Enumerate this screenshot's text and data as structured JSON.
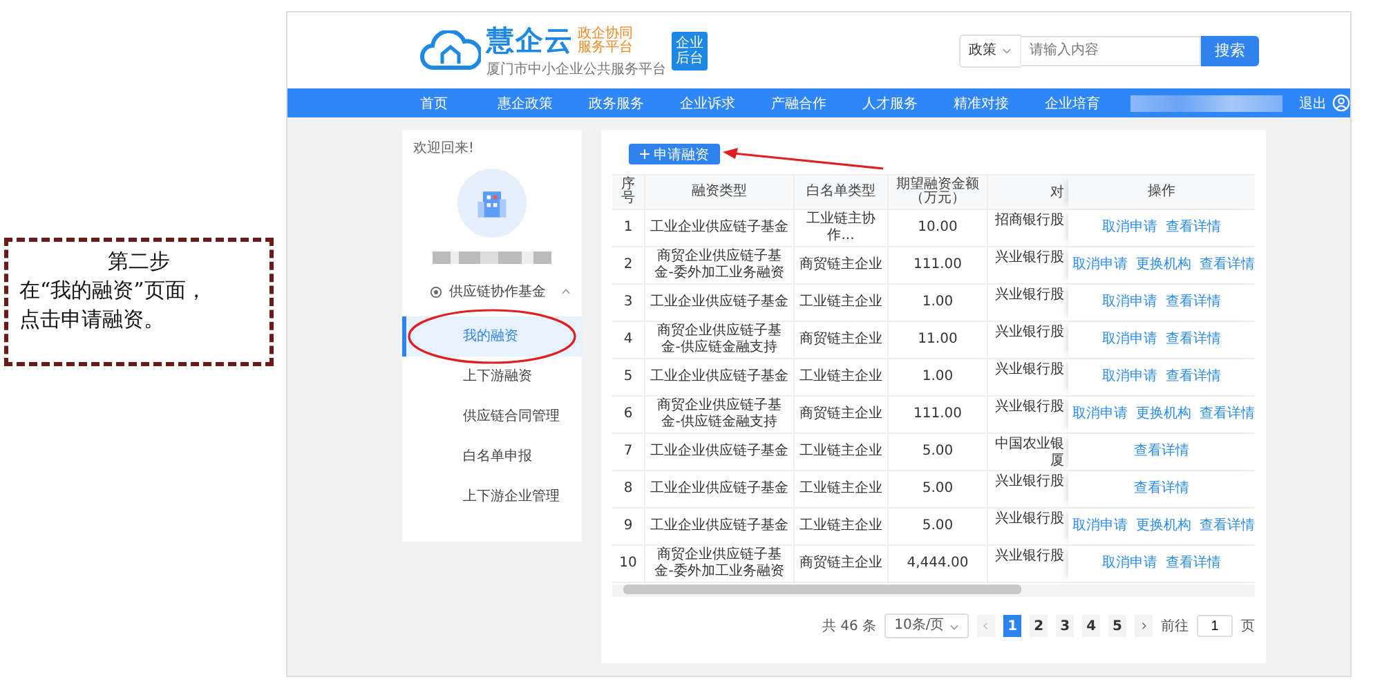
{
  "annotation": {
    "title": "第二步",
    "lines": [
      "在“我的融资”页面，",
      "点击申请融资。"
    ]
  },
  "header": {
    "brand": "慧企云",
    "slogan_lines": [
      "政企协同",
      "服务平台"
    ],
    "subtitle": "厦门市中小企业公共服务平台",
    "badge_lines": [
      "企业",
      "后台"
    ],
    "search": {
      "category": "政策",
      "placeholder": "请输入内容",
      "button": "搜索"
    }
  },
  "nav": {
    "items": [
      "首页",
      "惠企政策",
      "政务服务",
      "企业诉求",
      "产融合作",
      "人才服务",
      "精准对接",
      "企业培育"
    ],
    "logout": "退出"
  },
  "sidebar": {
    "welcome": "欢迎回来!",
    "group": {
      "label": "供应链协作基金",
      "expanded": true,
      "items": [
        {
          "label": "我的融资",
          "selected": true
        },
        {
          "label": "上下游融资",
          "selected": false
        },
        {
          "label": "供应链合同管理",
          "selected": false
        },
        {
          "label": "白名单申报",
          "selected": false
        },
        {
          "label": "上下游企业管理",
          "selected": false
        }
      ]
    }
  },
  "apply_button": "申请融资",
  "table": {
    "columns": [
      "序号",
      "融资类型",
      "白名单类型",
      "期望融资金额（万元）",
      "对",
      "操作"
    ],
    "rows": [
      {
        "no": "1",
        "type": "工业企业供应链子基金",
        "whitelist": "工业链主协作...",
        "amount": "10.00",
        "bank": [
          "招商银行股"
        ],
        "actions": [
          "取消申请",
          "查看详情"
        ]
      },
      {
        "no": "2",
        "type": "商贸企业供应链子基金-委外加工业务融资",
        "whitelist": "商贸链主企业",
        "amount": "111.00",
        "bank": [
          "兴业银行股"
        ],
        "actions": [
          "取消申请",
          "更换机构",
          "查看详情"
        ]
      },
      {
        "no": "3",
        "type": "工业企业供应链子基金",
        "whitelist": "工业链主企业",
        "amount": "1.00",
        "bank": [
          "兴业银行股"
        ],
        "actions": [
          "取消申请",
          "查看详情"
        ]
      },
      {
        "no": "4",
        "type": "商贸企业供应链子基金-供应链金融支持",
        "whitelist": "商贸链主企业",
        "amount": "11.00",
        "bank": [
          "兴业银行股"
        ],
        "actions": [
          "取消申请",
          "查看详情"
        ]
      },
      {
        "no": "5",
        "type": "工业企业供应链子基金",
        "whitelist": "工业链主企业",
        "amount": "1.00",
        "bank": [
          "兴业银行股"
        ],
        "actions": [
          "取消申请",
          "查看详情"
        ]
      },
      {
        "no": "6",
        "type": "商贸企业供应链子基金-供应链金融支持",
        "whitelist": "商贸链主企业",
        "amount": "111.00",
        "bank": [
          "兴业银行股"
        ],
        "actions": [
          "取消申请",
          "更换机构",
          "查看详情"
        ]
      },
      {
        "no": "7",
        "type": "工业企业供应链子基金",
        "whitelist": "工业链主企业",
        "amount": "5.00",
        "bank": [
          "中国农业银",
          "厦"
        ],
        "actions": [
          "查看详情"
        ]
      },
      {
        "no": "8",
        "type": "工业企业供应链子基金",
        "whitelist": "工业链主企业",
        "amount": "5.00",
        "bank": [
          "兴业银行股"
        ],
        "actions": [
          "查看详情"
        ]
      },
      {
        "no": "9",
        "type": "工业企业供应链子基金",
        "whitelist": "工业链主企业",
        "amount": "5.00",
        "bank": [
          "兴业银行股"
        ],
        "actions": [
          "取消申请",
          "更换机构",
          "查看详情"
        ]
      },
      {
        "no": "10",
        "type": "商贸企业供应链子基金-委外加工业务融资",
        "whitelist": "商贸链主企业",
        "amount": "4,444.00",
        "bank": [
          "兴业银行股"
        ],
        "actions": [
          "取消申请",
          "查看详情"
        ]
      }
    ]
  },
  "pagination": {
    "total": "共 46 条",
    "page_size": "10条/页",
    "pages": [
      {
        "label": "1",
        "selected": true
      },
      {
        "label": "2",
        "selected": false
      },
      {
        "label": "3",
        "selected": false
      },
      {
        "label": "4",
        "selected": false
      },
      {
        "label": "5",
        "selected": false
      }
    ],
    "goto_label": "前往",
    "goto_value": "1",
    "goto_suffix": "页"
  }
}
